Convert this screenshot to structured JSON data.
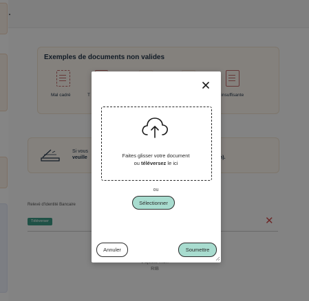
{
  "background": {
    "examples": {
      "title": "Exemples de documents non valides",
      "items": [
        {
          "label": "Mal cadré",
          "icon": "badly-framed-document-icon"
        },
        {
          "label": "T",
          "icon": "truncated-document-icon"
        },
        {
          "label": "",
          "icon": "blurry-document-icon"
        },
        {
          "label": "",
          "icon": "dark-document-icon"
        },
        {
          "label": "é insuffisante",
          "icon": "low-quality-document-icon"
        }
      ]
    },
    "info": {
      "line1": "Si vous",
      "line2": "veuille",
      "tail": "n)."
    },
    "rib": {
      "label": "Relevé d'Identité Bancaire",
      "upload_button": "Téléverser",
      "add_line1": "J'ajoute mon",
      "add_line2": "RIB"
    }
  },
  "modal": {
    "dropzone": {
      "line1": "Faites glisser votre document",
      "line2_prefix": "ou ",
      "line2_bold": "téléversez",
      "line2_suffix": " le ici"
    },
    "or_text": "ou",
    "select_button": "Sélectionner",
    "cancel_button": "Annuler",
    "submit_button": "Soumettre"
  },
  "colors": {
    "overlay": "#000000",
    "accent_teal": "#a8dccf",
    "upload_button": "#3d9b86",
    "warning_panel": "#fdf7ef",
    "remove_red": "#d24b4b"
  }
}
